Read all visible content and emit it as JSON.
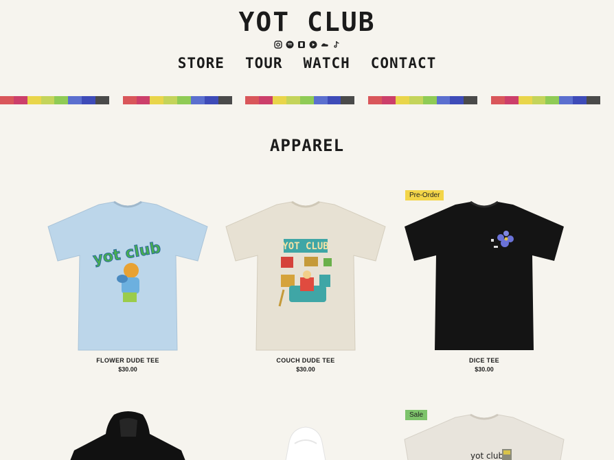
{
  "brand": "YOT CLUB",
  "socials": [
    "instagram-icon",
    "spotify-icon",
    "apple-music-icon",
    "youtube-icon",
    "soundcloud-icon",
    "tiktok-icon"
  ],
  "nav": [
    "STORE",
    "TOUR",
    "WATCH",
    "CONTACT"
  ],
  "stripe_colors": [
    "#d9565a",
    "#cc3f6a",
    "#e9d54a",
    "#c4d45a",
    "#8fcb55",
    "#5b6fcf",
    "#3e4bb8",
    "#4a4a4a",
    "#f6f4ee"
  ],
  "section_title": "APPAREL",
  "products": [
    {
      "name": "FLOWER DUDE TEE",
      "price": "$30.00",
      "badge": "",
      "color": "#bcd6ea",
      "graphic": "yot club"
    },
    {
      "name": "COUCH DUDE TEE",
      "price": "$30.00",
      "badge": "",
      "color": "#e7e1d3",
      "graphic": "YOT CLUB"
    },
    {
      "name": "DICE TEE",
      "price": "$30.00",
      "badge": "Pre-Order",
      "color": "#141414",
      "graphic": ""
    }
  ],
  "second_row": [
    {
      "badge": "",
      "color": "#111111"
    },
    {
      "badge": "",
      "color": "#ffffff"
    },
    {
      "badge": "Sale",
      "color": "#e8e4dc",
      "graphic": "yot club"
    }
  ],
  "badge_colors": {
    "Pre-Order": "#f3d548",
    "Sale": "#7dc36b"
  }
}
